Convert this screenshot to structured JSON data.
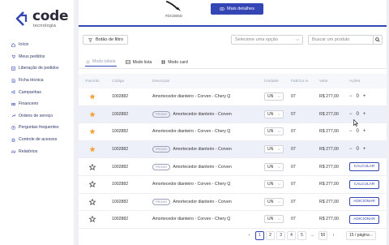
{
  "brand": {
    "name": "code",
    "subtitle": "tecnologia",
    "color": "#3446b3"
  },
  "sidebar": {
    "items": [
      {
        "label": "Início",
        "icon": "home-icon"
      },
      {
        "label": "Meus pedidos",
        "icon": "cart-icon"
      },
      {
        "label": "Liberação de pedidos",
        "icon": "check-list-icon"
      },
      {
        "label": "Ficha técnica",
        "icon": "document-icon"
      },
      {
        "label": "Campanhas",
        "icon": "megaphone-icon"
      },
      {
        "label": "Financeiro",
        "icon": "money-icon"
      },
      {
        "label": "Ordens de serviço",
        "icon": "wrench-icon"
      },
      {
        "label": "Perguntas frequentes",
        "icon": "question-icon"
      },
      {
        "label": "Controle de acessos",
        "icon": "lock-icon"
      },
      {
        "label": "Relatórios",
        "icon": "chart-icon"
      }
    ]
  },
  "header": {
    "image_tag": "#DCDB5D",
    "details_label": "Mais detalhes"
  },
  "filters": {
    "filter_button": "Botão de filtro",
    "select_placeholder": "Selecione uma opção",
    "search_placeholder": "Buscar um produto"
  },
  "view_tabs": [
    {
      "label": "Modo tabela",
      "active": true
    },
    {
      "label": "Modo lista",
      "active": false
    },
    {
      "label": "Modo card",
      "active": false
    }
  ],
  "table": {
    "columns": [
      "Favorito",
      "Código",
      "Descrição",
      "Unidade",
      "Fabrica m",
      "Valor",
      "Ações"
    ],
    "rows": [
      {
        "favorite": true,
        "code": "1002882",
        "promo": false,
        "promo_label": "",
        "description": "Amortecedor dianteiro - Corven - Chery Q",
        "unit": "UN",
        "box": "07",
        "price": "R$ 277,00",
        "action": "stepper",
        "qty": "0",
        "action_label": "",
        "highlight": false
      },
      {
        "favorite": true,
        "code": "1002882",
        "promo": true,
        "promo_label": "PROMO",
        "description": "Amortecedor dianteiro - Corven",
        "unit": "UN",
        "box": "07",
        "price": "R$ 277,00",
        "action": "stepper",
        "qty": "0",
        "action_label": "",
        "highlight": true
      },
      {
        "favorite": true,
        "code": "1002882",
        "promo": false,
        "promo_label": "",
        "description": "Amortecedor dianteiro - Corven - Chery Q",
        "unit": "UN",
        "box": "07",
        "price": "R$ 277,00",
        "action": "stepper",
        "qty": "0",
        "action_label": "",
        "highlight": false
      },
      {
        "favorite": true,
        "code": "1002882",
        "promo": true,
        "promo_label": "PROMO",
        "description": "Amortecedor dianteiro - Corven",
        "unit": "UN",
        "box": "07",
        "price": "R$ 277,00",
        "action": "stepper",
        "qty": "0",
        "action_label": "",
        "highlight": true
      },
      {
        "favorite": false,
        "code": "1002882",
        "promo": true,
        "promo_label": "PROMO",
        "description": "Amortecedor dianteiro - Corven",
        "unit": "UN",
        "box": "07",
        "price": "R$ 277,00",
        "action": "button",
        "qty": "",
        "action_label": "CALCULAR",
        "highlight": false
      },
      {
        "favorite": false,
        "code": "1002882",
        "promo": false,
        "promo_label": "",
        "description": "Amortecedor dianteiro - Corven - Chery Q",
        "unit": "UN",
        "box": "07",
        "price": "R$ 277,00",
        "action": "button",
        "qty": "",
        "action_label": "CALCULAR",
        "highlight": false
      },
      {
        "favorite": false,
        "code": "1002882",
        "promo": true,
        "promo_label": "PROMO",
        "description": "Amortecedor dianteiro - Corven",
        "unit": "UN",
        "box": "07",
        "price": "R$ 277,00",
        "action": "button",
        "qty": "",
        "action_label": "ADICIONAR",
        "highlight": false
      },
      {
        "favorite": false,
        "code": "1002882",
        "promo": false,
        "promo_label": "",
        "description": "Amortecedor dianteiro - Corven - Chery Q",
        "unit": "UN",
        "box": "07",
        "price": "R$ 277,00",
        "action": "button",
        "qty": "",
        "action_label": "ADICIONAR",
        "highlight": false
      }
    ]
  },
  "pagination": {
    "pages": [
      "1",
      "2",
      "3",
      "4",
      "5",
      "...",
      "50"
    ],
    "current": "1",
    "per_page": "15 / página"
  },
  "colors": {
    "accent": "#3446b3",
    "star": "#f2a33a",
    "row_highlight": "#eef0f9"
  }
}
